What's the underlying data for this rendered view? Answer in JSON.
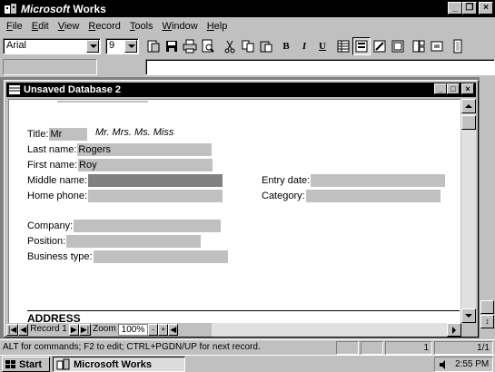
{
  "app": {
    "title_prefix": "Microsoft",
    "title_suffix": " Works"
  },
  "menu": [
    "File",
    "Edit",
    "View",
    "Record",
    "Tools",
    "Window",
    "Help"
  ],
  "menu_underline": [
    "F",
    "E",
    "V",
    "R",
    "T",
    "W",
    "H"
  ],
  "toolbar": {
    "font_name": "Arial",
    "font_size": "9",
    "bold_label": "B",
    "italic_label": "I",
    "underline_label": "U"
  },
  "document": {
    "title": "Unsaved Database 2"
  },
  "form": {
    "title_label": "Title:",
    "title_value": "Mr",
    "title_hint": "Mr. Mrs. Ms. Miss",
    "last_name_label": "Last name:",
    "last_name_value": "Rogers",
    "first_name_label": "First name:",
    "first_name_value": "Roy",
    "middle_name_label": "Middle name:",
    "middle_name_value": "",
    "home_phone_label": "Home phone:",
    "home_phone_value": "",
    "entry_date_label": "Entry date:",
    "entry_date_value": "",
    "category_label": "Category:",
    "category_value": "",
    "company_label": "Company:",
    "company_value": "",
    "position_label": "Position:",
    "position_value": "",
    "business_type_label": "Business type:",
    "business_type_value": "",
    "address_heading": "ADDRESS"
  },
  "navigation": {
    "record_label": "Record 1",
    "zoom_label": "Zoom",
    "zoom_value": "100%",
    "zoom_minus": "-",
    "zoom_plus": "+"
  },
  "status": {
    "hint": "ALT for commands; F2 to edit; CTRL+PGDN/UP for next record.",
    "record_number": "1",
    "record_count": "1/1"
  },
  "taskbar": {
    "start_label": "Start",
    "task_label": "Microsoft Works",
    "clock": "2:55 PM"
  }
}
